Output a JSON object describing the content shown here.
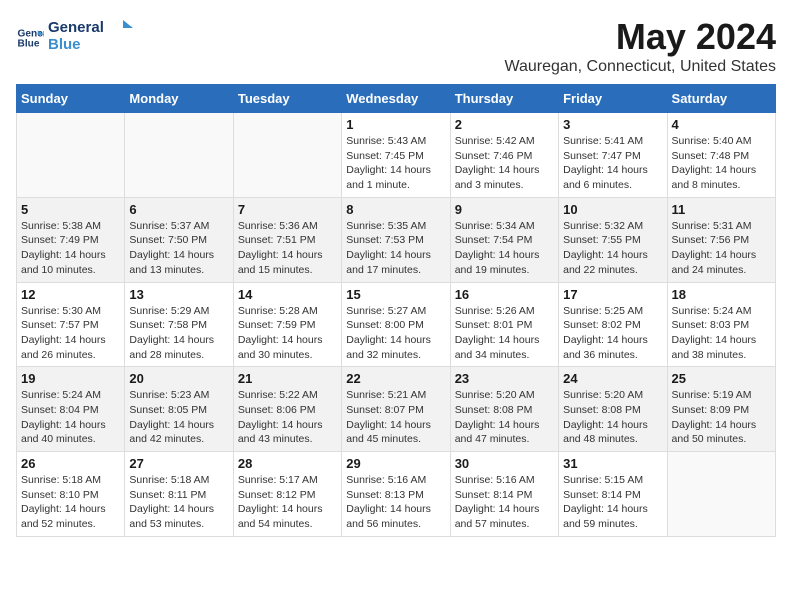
{
  "logo": {
    "line1": "General",
    "line2": "Blue"
  },
  "title": "May 2024",
  "subtitle": "Wauregan, Connecticut, United States",
  "days_header": [
    "Sunday",
    "Monday",
    "Tuesday",
    "Wednesday",
    "Thursday",
    "Friday",
    "Saturday"
  ],
  "weeks": [
    [
      {
        "day": "",
        "info": ""
      },
      {
        "day": "",
        "info": ""
      },
      {
        "day": "",
        "info": ""
      },
      {
        "day": "1",
        "info": "Sunrise: 5:43 AM\nSunset: 7:45 PM\nDaylight: 14 hours\nand 1 minute."
      },
      {
        "day": "2",
        "info": "Sunrise: 5:42 AM\nSunset: 7:46 PM\nDaylight: 14 hours\nand 3 minutes."
      },
      {
        "day": "3",
        "info": "Sunrise: 5:41 AM\nSunset: 7:47 PM\nDaylight: 14 hours\nand 6 minutes."
      },
      {
        "day": "4",
        "info": "Sunrise: 5:40 AM\nSunset: 7:48 PM\nDaylight: 14 hours\nand 8 minutes."
      }
    ],
    [
      {
        "day": "5",
        "info": "Sunrise: 5:38 AM\nSunset: 7:49 PM\nDaylight: 14 hours\nand 10 minutes."
      },
      {
        "day": "6",
        "info": "Sunrise: 5:37 AM\nSunset: 7:50 PM\nDaylight: 14 hours\nand 13 minutes."
      },
      {
        "day": "7",
        "info": "Sunrise: 5:36 AM\nSunset: 7:51 PM\nDaylight: 14 hours\nand 15 minutes."
      },
      {
        "day": "8",
        "info": "Sunrise: 5:35 AM\nSunset: 7:53 PM\nDaylight: 14 hours\nand 17 minutes."
      },
      {
        "day": "9",
        "info": "Sunrise: 5:34 AM\nSunset: 7:54 PM\nDaylight: 14 hours\nand 19 minutes."
      },
      {
        "day": "10",
        "info": "Sunrise: 5:32 AM\nSunset: 7:55 PM\nDaylight: 14 hours\nand 22 minutes."
      },
      {
        "day": "11",
        "info": "Sunrise: 5:31 AM\nSunset: 7:56 PM\nDaylight: 14 hours\nand 24 minutes."
      }
    ],
    [
      {
        "day": "12",
        "info": "Sunrise: 5:30 AM\nSunset: 7:57 PM\nDaylight: 14 hours\nand 26 minutes."
      },
      {
        "day": "13",
        "info": "Sunrise: 5:29 AM\nSunset: 7:58 PM\nDaylight: 14 hours\nand 28 minutes."
      },
      {
        "day": "14",
        "info": "Sunrise: 5:28 AM\nSunset: 7:59 PM\nDaylight: 14 hours\nand 30 minutes."
      },
      {
        "day": "15",
        "info": "Sunrise: 5:27 AM\nSunset: 8:00 PM\nDaylight: 14 hours\nand 32 minutes."
      },
      {
        "day": "16",
        "info": "Sunrise: 5:26 AM\nSunset: 8:01 PM\nDaylight: 14 hours\nand 34 minutes."
      },
      {
        "day": "17",
        "info": "Sunrise: 5:25 AM\nSunset: 8:02 PM\nDaylight: 14 hours\nand 36 minutes."
      },
      {
        "day": "18",
        "info": "Sunrise: 5:24 AM\nSunset: 8:03 PM\nDaylight: 14 hours\nand 38 minutes."
      }
    ],
    [
      {
        "day": "19",
        "info": "Sunrise: 5:24 AM\nSunset: 8:04 PM\nDaylight: 14 hours\nand 40 minutes."
      },
      {
        "day": "20",
        "info": "Sunrise: 5:23 AM\nSunset: 8:05 PM\nDaylight: 14 hours\nand 42 minutes."
      },
      {
        "day": "21",
        "info": "Sunrise: 5:22 AM\nSunset: 8:06 PM\nDaylight: 14 hours\nand 43 minutes."
      },
      {
        "day": "22",
        "info": "Sunrise: 5:21 AM\nSunset: 8:07 PM\nDaylight: 14 hours\nand 45 minutes."
      },
      {
        "day": "23",
        "info": "Sunrise: 5:20 AM\nSunset: 8:08 PM\nDaylight: 14 hours\nand 47 minutes."
      },
      {
        "day": "24",
        "info": "Sunrise: 5:20 AM\nSunset: 8:08 PM\nDaylight: 14 hours\nand 48 minutes."
      },
      {
        "day": "25",
        "info": "Sunrise: 5:19 AM\nSunset: 8:09 PM\nDaylight: 14 hours\nand 50 minutes."
      }
    ],
    [
      {
        "day": "26",
        "info": "Sunrise: 5:18 AM\nSunset: 8:10 PM\nDaylight: 14 hours\nand 52 minutes."
      },
      {
        "day": "27",
        "info": "Sunrise: 5:18 AM\nSunset: 8:11 PM\nDaylight: 14 hours\nand 53 minutes."
      },
      {
        "day": "28",
        "info": "Sunrise: 5:17 AM\nSunset: 8:12 PM\nDaylight: 14 hours\nand 54 minutes."
      },
      {
        "day": "29",
        "info": "Sunrise: 5:16 AM\nSunset: 8:13 PM\nDaylight: 14 hours\nand 56 minutes."
      },
      {
        "day": "30",
        "info": "Sunrise: 5:16 AM\nSunset: 8:14 PM\nDaylight: 14 hours\nand 57 minutes."
      },
      {
        "day": "31",
        "info": "Sunrise: 5:15 AM\nSunset: 8:14 PM\nDaylight: 14 hours\nand 59 minutes."
      },
      {
        "day": "",
        "info": ""
      }
    ]
  ]
}
